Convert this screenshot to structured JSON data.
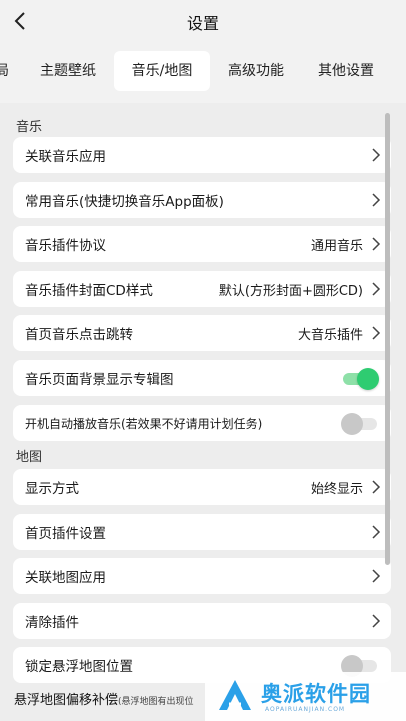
{
  "header": {
    "title": "设置"
  },
  "tabs": [
    {
      "label": "局"
    },
    {
      "label": "主题壁纸"
    },
    {
      "label": "音乐/地图",
      "active": true
    },
    {
      "label": "高级功能"
    },
    {
      "label": "其他设置"
    }
  ],
  "music": {
    "section_label": "音乐",
    "rows": [
      {
        "label": "关联音乐应用",
        "value": "",
        "control": "chevron"
      },
      {
        "label": "常用音乐(快捷切换音乐App面板)",
        "value": "",
        "control": "chevron"
      },
      {
        "label": "音乐插件协议",
        "value": "通用音乐",
        "control": "chevron"
      },
      {
        "label": "音乐插件封面CD样式",
        "value": "默认(方形封面+圆形CD)",
        "control": "chevron"
      },
      {
        "label": "首页音乐点击跳转",
        "value": "大音乐插件",
        "control": "chevron"
      },
      {
        "label": "音乐页面背景显示专辑图",
        "value": "",
        "control": "toggle",
        "on": true
      },
      {
        "label": "开机自动播放音乐(若效果不好请用计划任务)",
        "value": "",
        "control": "toggle",
        "on": false
      }
    ]
  },
  "map": {
    "section_label": "地图",
    "rows": [
      {
        "label": "显示方式",
        "value": "始终显示",
        "control": "chevron"
      },
      {
        "label": "首页插件设置",
        "value": "",
        "control": "chevron"
      },
      {
        "label": "关联地图应用",
        "value": "",
        "control": "chevron"
      },
      {
        "label": "清除插件",
        "value": "",
        "control": "chevron"
      },
      {
        "label": "锁定悬浮地图位置",
        "value": "",
        "control": "toggle",
        "on": false
      }
    ],
    "bottom_label": "悬浮地图偏移补偿",
    "bottom_note": "(悬浮地图有出现位"
  },
  "watermark": {
    "text": "奥派软件园",
    "sub": "AOPAIRUANJIAN.COM"
  },
  "colors": {
    "accent": "#2ecc71",
    "toggle_track_on": "#8ee0a8",
    "toggle_off": "#c8c8c8",
    "watermark": "#2aa0e8"
  }
}
